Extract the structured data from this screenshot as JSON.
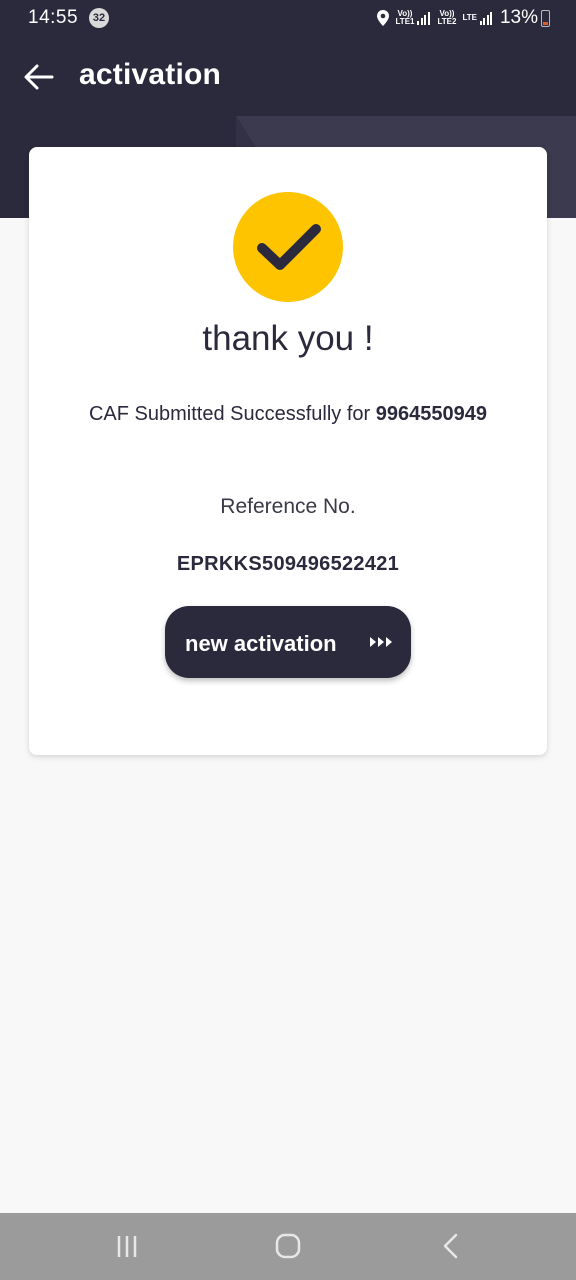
{
  "status_bar": {
    "time": "14:55",
    "notification_count": "32",
    "sim1_label": [
      "Vo))",
      "LTE1"
    ],
    "sim2_label": [
      "Vo))",
      "LTE2"
    ],
    "network_type": "LTE",
    "battery": "13%"
  },
  "header": {
    "title": "activation",
    "back_icon": "arrow-left-icon"
  },
  "card": {
    "status_icon": "checkmark-icon",
    "thank_you": "thank you !",
    "caf_text": "CAF Submitted Successfully for ",
    "caf_number": "9964550949",
    "reference_label": "Reference No.",
    "reference_value": "EPRKKS509496522421",
    "button_label": "new activation",
    "button_icon": "triple-chevron-right-icon"
  },
  "nav_bar": {
    "items": [
      "recent-apps-icon",
      "home-icon",
      "back-icon"
    ]
  },
  "colors": {
    "primary": "#2b2a3d",
    "accent": "#ffc400",
    "background": "#f8f8f8",
    "nav_bar": "#9b9b9b"
  }
}
